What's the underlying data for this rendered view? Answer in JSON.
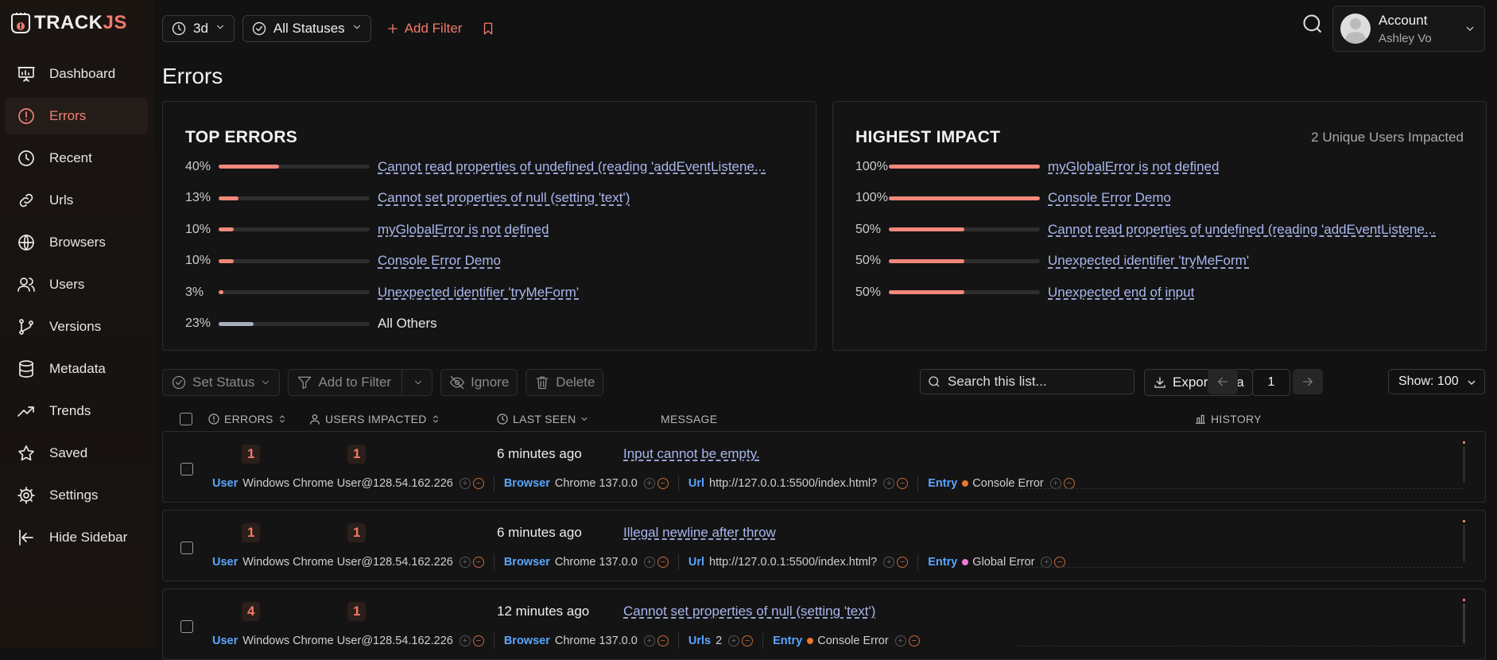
{
  "brand": {
    "track": "TRACK",
    "js": "JS"
  },
  "sidebar": {
    "items": [
      {
        "label": "Dashboard",
        "icon": "dashboard-icon"
      },
      {
        "label": "Errors",
        "icon": "error-circle-icon",
        "active": true
      },
      {
        "label": "Recent",
        "icon": "clock-icon"
      },
      {
        "label": "Urls",
        "icon": "link-icon"
      },
      {
        "label": "Browsers",
        "icon": "globe-icon"
      },
      {
        "label": "Users",
        "icon": "users-icon"
      },
      {
        "label": "Versions",
        "icon": "branch-icon"
      },
      {
        "label": "Metadata",
        "icon": "database-icon"
      },
      {
        "label": "Trends",
        "icon": "trend-icon"
      },
      {
        "label": "Saved",
        "icon": "star-icon"
      },
      {
        "label": "Settings",
        "icon": "gear-icon"
      },
      {
        "label": "Hide Sidebar",
        "icon": "collapse-icon"
      }
    ]
  },
  "topbar": {
    "time_range": "3d",
    "status": "All Statuses",
    "add_filter": "Add Filter"
  },
  "account": {
    "title": "Account",
    "name": "Ashley Vo"
  },
  "page_title": "Errors",
  "top_errors": {
    "title": "TOP ERRORS",
    "rows": [
      {
        "pct": "40%",
        "fill": 0.4,
        "label": "Cannot read properties of undefined (reading 'addEventListene...",
        "link": true
      },
      {
        "pct": "13%",
        "fill": 0.13,
        "label": "Cannot set properties of null (setting 'text')",
        "link": true
      },
      {
        "pct": "10%",
        "fill": 0.1,
        "label": "myGlobalError is not defined",
        "link": true
      },
      {
        "pct": "10%",
        "fill": 0.1,
        "label": "Console Error Demo",
        "link": true
      },
      {
        "pct": "3%",
        "fill": 0.03,
        "label": "Unexpected identifier 'tryMeForm'",
        "link": true
      },
      {
        "pct": "23%",
        "fill": 0.23,
        "label": "All Others",
        "link": false
      }
    ]
  },
  "highest_impact": {
    "title": "HIGHEST IMPACT",
    "subtitle": "2 Unique Users Impacted",
    "rows": [
      {
        "pct": "100%",
        "fill": 1.0,
        "label": "myGlobalError is not defined"
      },
      {
        "pct": "100%",
        "fill": 1.0,
        "label": "Console Error Demo"
      },
      {
        "pct": "50%",
        "fill": 0.5,
        "label": "Cannot read properties of undefined (reading 'addEventListene..."
      },
      {
        "pct": "50%",
        "fill": 0.5,
        "label": "Unexpected identifier 'tryMeForm'"
      },
      {
        "pct": "50%",
        "fill": 0.5,
        "label": "Unexpected end of input"
      }
    ]
  },
  "toolbar": {
    "set_status": "Set Status",
    "add_to_filter": "Add to Filter",
    "ignore": "Ignore",
    "delete": "Delete",
    "search_placeholder": "Search this list...",
    "export": "Export Data",
    "page": "1",
    "show": "Show: 100"
  },
  "table": {
    "headers": {
      "errors": "ERRORS",
      "users_impacted": "USERS IMPACTED",
      "last_seen": "LAST SEEN",
      "message": "MESSAGE",
      "history": "HISTORY"
    },
    "rows": [
      {
        "errors": "1",
        "users": "1",
        "last_seen": "6 minutes ago",
        "message": "Input cannot be empty.",
        "user_key": "User",
        "user": "Windows Chrome User@128.54.162.226",
        "browser_key": "Browser",
        "browser": "Chrome 137.0.0",
        "url_key": "Url",
        "url": "http://127.0.0.1:5500/index.html?",
        "entry_key": "Entry",
        "entry": "Console Error",
        "entry_color": "#e8772e"
      },
      {
        "errors": "1",
        "users": "1",
        "last_seen": "6 minutes ago",
        "message": "Illegal newline after throw",
        "user_key": "User",
        "user": "Windows Chrome User@128.54.162.226",
        "browser_key": "Browser",
        "browser": "Chrome 137.0.0",
        "url_key": "Url",
        "url": "http://127.0.0.1:5500/index.html?",
        "entry_key": "Entry",
        "entry": "Global Error",
        "entry_color": "#f07ae0"
      },
      {
        "errors": "4",
        "users": "1",
        "last_seen": "12 minutes ago",
        "message": "Cannot set properties of null (setting 'text')",
        "user_key": "User",
        "user": "Windows Chrome User@128.54.162.226",
        "browser_key": "Browser",
        "browser": "Chrome 137.0.0",
        "url_key": "Urls",
        "url": "2",
        "entry_key": "Entry",
        "entry": "Console Error",
        "entry_color": "#e8772e"
      }
    ]
  },
  "colors": {
    "accent": "#f07a6a",
    "link": "#a9b7ee",
    "meta_key": "#5aa5ff"
  }
}
